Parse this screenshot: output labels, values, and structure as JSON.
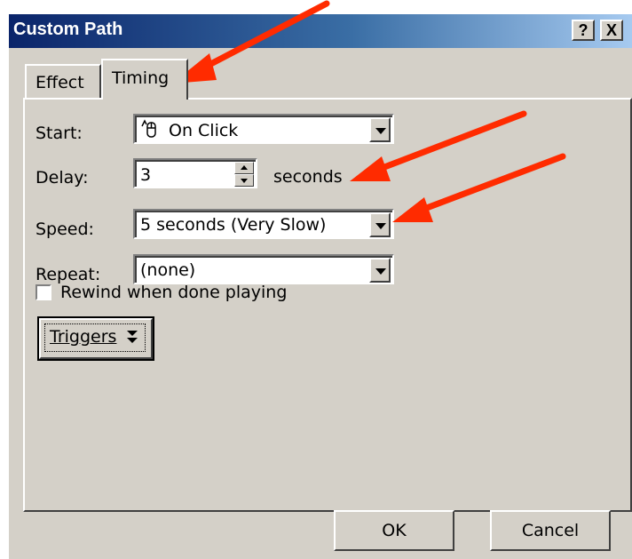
{
  "window": {
    "title": "Custom Path",
    "help_label": "?",
    "close_label": "X"
  },
  "tabs": [
    {
      "label": "Effect",
      "selected": false
    },
    {
      "label": "Timing",
      "selected": true
    }
  ],
  "timing": {
    "start": {
      "label": "Start:",
      "value": "On Click",
      "icon": "mouse-click-icon"
    },
    "delay": {
      "label": "Delay:",
      "value": "3",
      "unit": "seconds"
    },
    "speed": {
      "label": "Speed:",
      "value": "5 seconds (Very Slow)"
    },
    "repeat": {
      "label": "Repeat:",
      "value": "(none)"
    },
    "rewind": {
      "label": "Rewind when done playing",
      "checked": false
    },
    "triggers_label": "Triggers",
    "triggers_icon": "double-chevron-down-icon"
  },
  "footer": {
    "ok_label": "OK",
    "cancel_label": "Cancel"
  },
  "annotations": {
    "arrow_color": "#ff2b00",
    "arrows": [
      "pointing-to-timing-tab",
      "pointing-to-seconds",
      "pointing-to-speed-dropdown"
    ]
  }
}
